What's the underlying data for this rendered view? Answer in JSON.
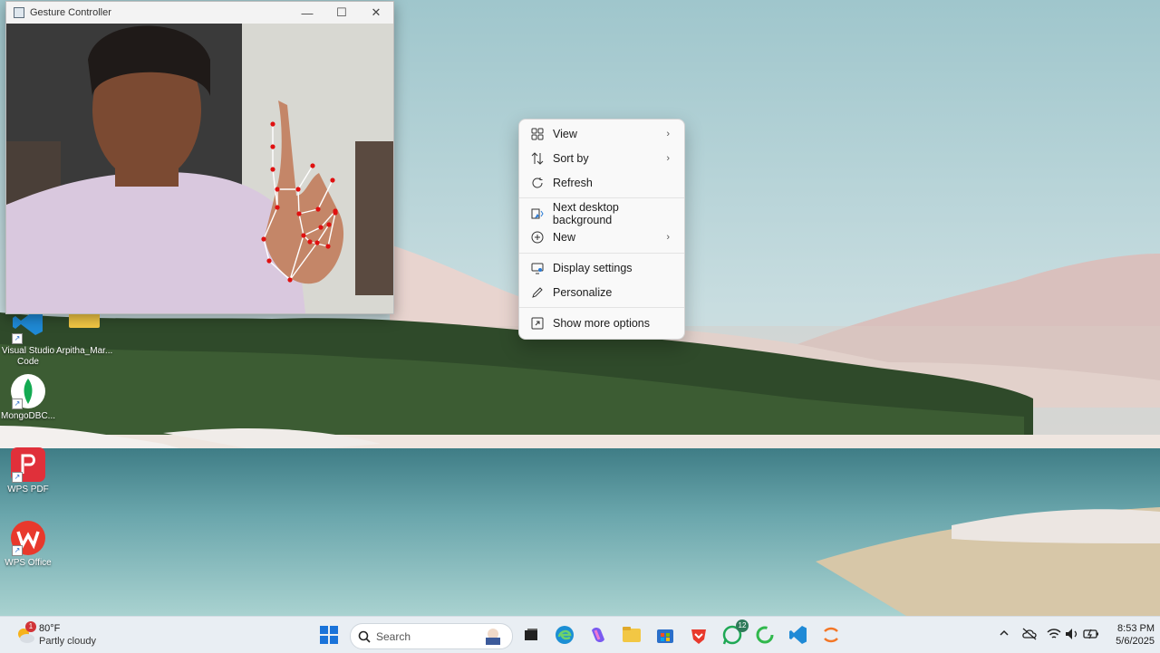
{
  "window": {
    "title": "Gesture Controller",
    "controls": {
      "minimize": "—",
      "maximize": "☐",
      "close": "✕"
    }
  },
  "desktop_icons": [
    {
      "label": "Visual Studio Code",
      "icon": "vscode-icon"
    },
    {
      "label": "Arpitha_Mar...",
      "icon": "folder-icon"
    },
    {
      "label": "MongoDBC...",
      "icon": "mongodb-icon"
    },
    {
      "label": "WPS PDF",
      "icon": "wps-pdf-icon"
    },
    {
      "label": "WPS Office",
      "icon": "wps-office-icon"
    }
  ],
  "context_menu": {
    "items": [
      {
        "label": "View",
        "icon": "grid-icon",
        "submenu": true
      },
      {
        "label": "Sort by",
        "icon": "sort-icon",
        "submenu": true
      },
      {
        "label": "Refresh",
        "icon": "refresh-icon",
        "submenu": false
      },
      {
        "label": "Next desktop background",
        "icon": "next-background-icon",
        "submenu": false
      },
      {
        "label": "New",
        "icon": "plus-icon",
        "submenu": true
      },
      {
        "label": "Display settings",
        "icon": "display-icon",
        "submenu": false
      },
      {
        "label": "Personalize",
        "icon": "pen-icon",
        "submenu": false
      },
      {
        "label": "Show more options",
        "icon": "more-options-icon",
        "submenu": false
      }
    ],
    "chevron": "›"
  },
  "taskbar": {
    "weather": {
      "temp": "80°F",
      "desc": "Partly cloudy",
      "badge": "1"
    },
    "search": {
      "placeholder": "Search"
    },
    "whatsapp_badge": "12",
    "apps": [
      "start-icon",
      "search-icon",
      "task-view-icon",
      "edge-icon",
      "copilot-icon",
      "file-explorer-icon",
      "store-icon",
      "brave-icon",
      "whatsapp-icon",
      "spinner-app-icon",
      "vscode-icon",
      "jupyter-icon"
    ],
    "tray": {
      "time": "8:53 PM",
      "date": "5/6/2025",
      "icons": [
        "chevron-up-icon",
        "cloud-off-icon",
        "wifi-icon",
        "volume-icon",
        "battery-icon"
      ]
    }
  },
  "colors": {
    "menu_bg": "#f9f9f9",
    "taskbar_bg": "#e9eef3",
    "landmark_red": "#e01010",
    "vscode_blue": "#1f8ad6"
  }
}
